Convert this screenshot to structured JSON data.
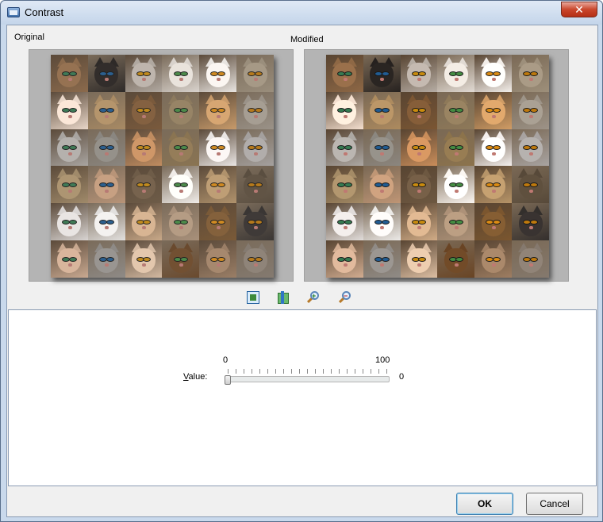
{
  "window": {
    "title": "Contrast",
    "close_symbol": "✕"
  },
  "preview": {
    "original_label": "Original",
    "modified_label": "Modified"
  },
  "toolbar": {
    "icons": [
      "fit-to-window-icon",
      "actual-size-icon",
      "zoom-in-icon",
      "zoom-out-icon"
    ]
  },
  "slider": {
    "label": "Value:",
    "label_mnemonic": "V",
    "label_rest": "alue:",
    "min": 0,
    "max": 100,
    "min_label": "0",
    "max_label": "100",
    "value": 0,
    "value_text": "0"
  },
  "buttons": {
    "ok": "OK",
    "cancel": "Cancel"
  },
  "colors": {
    "fur": [
      "#8b6a4c",
      "#2e2a28",
      "#b0a8a0",
      "#d8d2cc",
      "#e8e4e0",
      "#9a8e7c",
      "#e8d6c8",
      "#a88a64",
      "#7a5a3c",
      "#8c7a5e",
      "#c79a6a",
      "#9a9288",
      "#a8a4a0",
      "#8a8680",
      "#c08c60",
      "#8a7452",
      "#e9e5e3",
      "#a4a09e",
      "#a08a6a",
      "#b89478",
      "#6e5c48",
      "#f0ece8",
      "#b0926c",
      "#5a4e40",
      "#d8d4d2",
      "#e2e0de",
      "#c8a888",
      "#a8907a",
      "#7a5a38",
      "#3a3634",
      "#c8a890",
      "#8e8a86",
      "#d2b8a0",
      "#6a4a2e",
      "#9a7e66",
      "#847a70"
    ],
    "eyes": [
      "#3f7a56",
      "#2c5f8e",
      "#c08a1e",
      "#4c8a4a",
      "#d08a22",
      "#b67a1c"
    ]
  }
}
